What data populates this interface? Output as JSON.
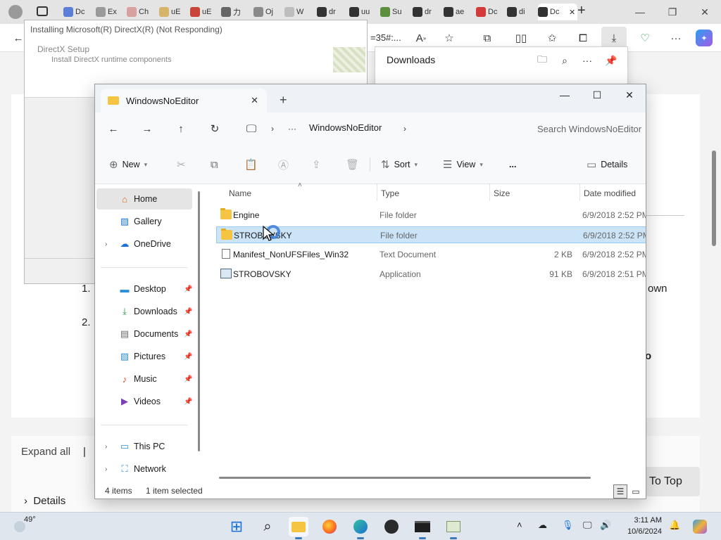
{
  "browser": {
    "tabs": [
      {
        "label": "Dc",
        "color": "#5b7fd6"
      },
      {
        "label": "Ex",
        "color": "#9a9a9a"
      },
      {
        "label": "Ch",
        "color": "#d9a0a0"
      },
      {
        "label": "uE",
        "color": "#d6b46a"
      },
      {
        "label": "uE",
        "color": "#c9453a"
      },
      {
        "label": "力",
        "color": "#666666"
      },
      {
        "label": "Oj",
        "color": "#8a8a8a"
      },
      {
        "label": "W",
        "color": "#bdbdbd"
      },
      {
        "label": "dr",
        "color": "#333333"
      },
      {
        "label": "uu",
        "color": "#333333"
      },
      {
        "label": "Su",
        "color": "#5e8f3e"
      },
      {
        "label": "dr",
        "color": "#333333"
      },
      {
        "label": "ae",
        "color": "#333333"
      },
      {
        "label": "Dc",
        "color": "#d43a3a"
      },
      {
        "label": "di",
        "color": "#333333"
      },
      {
        "label": "Dc",
        "color": "#333333"
      }
    ],
    "address_fragment": "=35#:...",
    "page": {
      "step1": "1.",
      "step2": "2.",
      "right_text": "own",
      "bold_frag": "o",
      "expand_all": "Expand all",
      "separator": "|",
      "details": "Details",
      "back_to_top": "To Top"
    }
  },
  "downloads_panel": {
    "title": "Downloads"
  },
  "directx_dialog": {
    "title": "Installing Microsoft(R) DirectX(R) (Not Responding)",
    "heading": "DirectX Setup",
    "subheading": "Install DirectX runtime components"
  },
  "explorer": {
    "tab_title": "WindowsNoEditor",
    "breadcrumb": "WindowsNoEditor",
    "search_placeholder": "Search WindowsNoEditor",
    "toolbar": {
      "new": "New",
      "sort": "Sort",
      "view": "View",
      "more": "...",
      "details": "Details"
    },
    "sidebar": [
      {
        "label": "Home",
        "icon": "home-icon",
        "selected": true
      },
      {
        "label": "Gallery",
        "icon": "gallery-icon"
      },
      {
        "label": "OneDrive",
        "icon": "cloud-icon",
        "expandable": true
      },
      {
        "label": "Desktop",
        "icon": "desktop-icon",
        "pinned": true
      },
      {
        "label": "Downloads",
        "icon": "download-icon",
        "pinned": true
      },
      {
        "label": "Documents",
        "icon": "documents-icon",
        "pinned": true
      },
      {
        "label": "Pictures",
        "icon": "pictures-icon",
        "pinned": true
      },
      {
        "label": "Music",
        "icon": "music-icon",
        "pinned": true
      },
      {
        "label": "Videos",
        "icon": "videos-icon",
        "pinned": true
      },
      {
        "label": "This PC",
        "icon": "pc-icon",
        "expandable": true
      },
      {
        "label": "Network",
        "icon": "network-icon",
        "expandable": true
      }
    ],
    "columns": [
      "Name",
      "Type",
      "Size",
      "Date modified"
    ],
    "files": [
      {
        "name": "Engine",
        "type": "File folder",
        "size": "",
        "date": "6/9/2018 2:52 PM",
        "kind": "folder"
      },
      {
        "name": "STROBOVSKY",
        "type": "File folder",
        "size": "",
        "date": "6/9/2018 2:52 PM",
        "kind": "folder",
        "selected": true
      },
      {
        "name": "Manifest_NonUFSFiles_Win32",
        "type": "Text Document",
        "size": "2 KB",
        "date": "6/9/2018 2:52 PM",
        "kind": "text"
      },
      {
        "name": "STROBOVSKY",
        "type": "Application",
        "size": "91 KB",
        "date": "6/9/2018 2:51 PM",
        "kind": "app"
      }
    ],
    "status": {
      "count": "4 items",
      "selection": "1 item selected"
    }
  },
  "taskbar": {
    "weather_temp": "49°",
    "time": "3:11 AM",
    "date": "10/6/2024"
  }
}
